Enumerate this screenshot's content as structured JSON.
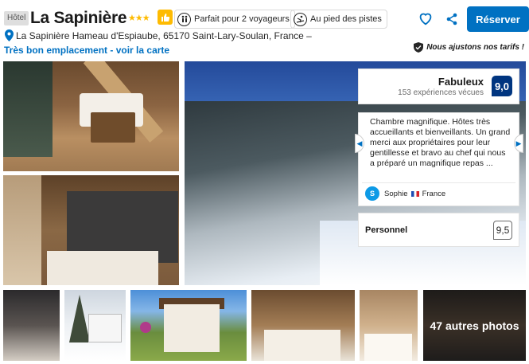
{
  "header": {
    "property_type": "Hôtel",
    "title": "La Sapinière",
    "stars": "★★★",
    "badges": [
      {
        "icon": "couple-icon",
        "label": "Parfait pour 2 voyageurs"
      },
      {
        "icon": "ski-icon",
        "label": "Au pied des pistes"
      }
    ],
    "reserve_label": "Réserver"
  },
  "address": {
    "text": "La Sapinière Hameau d'Espiaube, 65170 Saint-Lary-Soulan, France –",
    "location_link": "Très bon emplacement - voir la carte"
  },
  "price_note": "Nous ajustons nos tarifs !",
  "review_summary": {
    "word": "Fabuleux",
    "count": "153 expériences vécues",
    "score": "9,0"
  },
  "featured_review": {
    "text": "Chambre magnifique. Hôtes très accueillants et bienveillants. Un grand merci aux propriétaires pour leur gentillesse et bravo au chef qui nous a préparé un magnifique repas ...",
    "avatar_initial": "S",
    "author": "Sophie",
    "country": "France"
  },
  "category_score": {
    "label": "Personnel",
    "score": "9,5"
  },
  "gallery": {
    "more_photos_label": "47 autres photos"
  },
  "colors": {
    "brand_blue": "#0071c2",
    "score_navy": "#003580",
    "star_yellow": "#febb02"
  }
}
